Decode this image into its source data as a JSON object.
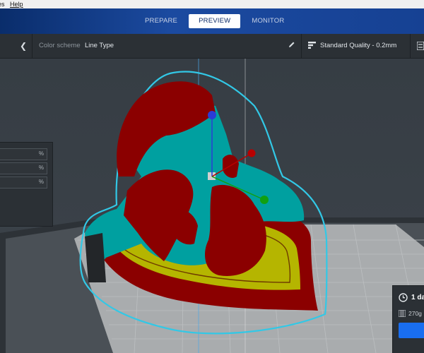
{
  "menu": {
    "items": [
      "es",
      "Help"
    ]
  },
  "stages": {
    "prepare": "PREPARE",
    "preview": "PREVIEW",
    "monitor": "MONITOR",
    "active": "PREVIEW"
  },
  "toolbar": {
    "color_scheme_label": "Color scheme",
    "color_scheme_value": "Line Type",
    "quality": "Standard Quality - 0.2mm"
  },
  "side_panel": {
    "unit_1": "%",
    "unit_2": "%",
    "unit_3": "%"
  },
  "print_info": {
    "time": "1 da",
    "weight": "270g"
  },
  "colors": {
    "accent_blue": "#196ef0",
    "header_blue": "#164193",
    "wall_outer": "#8b0000",
    "wall_inner": "#00a0a0",
    "skin": "#b5b500",
    "skirt": "#32c8e6"
  },
  "icons": [
    "back-chevron-icon",
    "pencil-icon",
    "quality-icon",
    "settings-icon",
    "clock-icon",
    "filament-icon"
  ]
}
